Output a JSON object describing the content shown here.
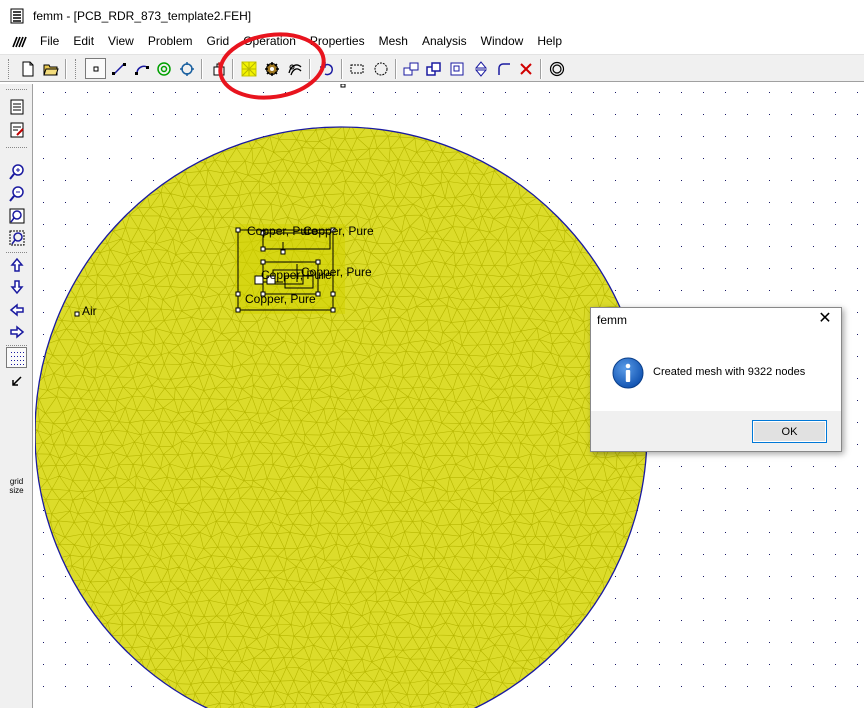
{
  "window": {
    "title": "femm - [PCB_RDR_873_template2.FEH]"
  },
  "menu": {
    "items": [
      "File",
      "Edit",
      "View",
      "Problem",
      "Grid",
      "Operation",
      "Properties",
      "Mesh",
      "Analysis",
      "Window",
      "Help"
    ]
  },
  "toolbar": {
    "buttons": [
      "new-file-icon",
      "open-folder-icon",
      "node-mode-icon",
      "segment-mode-icon",
      "arc-mode-icon",
      "block-label-icon",
      "group-mode-icon",
      "dxf-export-icon",
      "mesh-generate-icon",
      "analyze-icon",
      "view-results-icon",
      "undo-icon",
      "box-select-icon",
      "circle-select-icon",
      "move-icon",
      "copy-icon",
      "scale-icon",
      "mirror-icon",
      "fillet-icon",
      "delete-icon",
      "open-boundary-icon"
    ]
  },
  "left_toolbar": {
    "buttons": [
      "show-props-icon",
      "edit-props-icon",
      "zoom-in-icon",
      "zoom-out-icon",
      "zoom-natural-icon",
      "zoom-window-icon",
      "pan-up-icon",
      "pan-down-icon",
      "pan-left-icon",
      "pan-right-icon",
      "show-grid-icon",
      "snap-grid-icon"
    ],
    "grid_size_label": "grid size"
  },
  "canvas": {
    "labels": {
      "copper_top": "Copper, Pure",
      "copper_top_overlap": "Copper, Pure",
      "copper_mid": "Copper, Pure",
      "copper_mid_overlap": "Copper, Pure",
      "copper_bottom": "Copper, Pure",
      "air": "Air"
    },
    "colors": {
      "mesh": "#dcdc2a",
      "mesh_line": "#b6b600",
      "boundary": "#1a1aa0",
      "grid_dot": "#1a1a6a",
      "geometry": "#000000"
    }
  },
  "annotation": {
    "color": "#e8141e",
    "shape": "ellipse"
  },
  "dialog": {
    "title": "femm",
    "close_glyph": "✕",
    "message": "Created mesh with 9322 nodes",
    "ok_label": "OK",
    "icon": "info-icon"
  }
}
